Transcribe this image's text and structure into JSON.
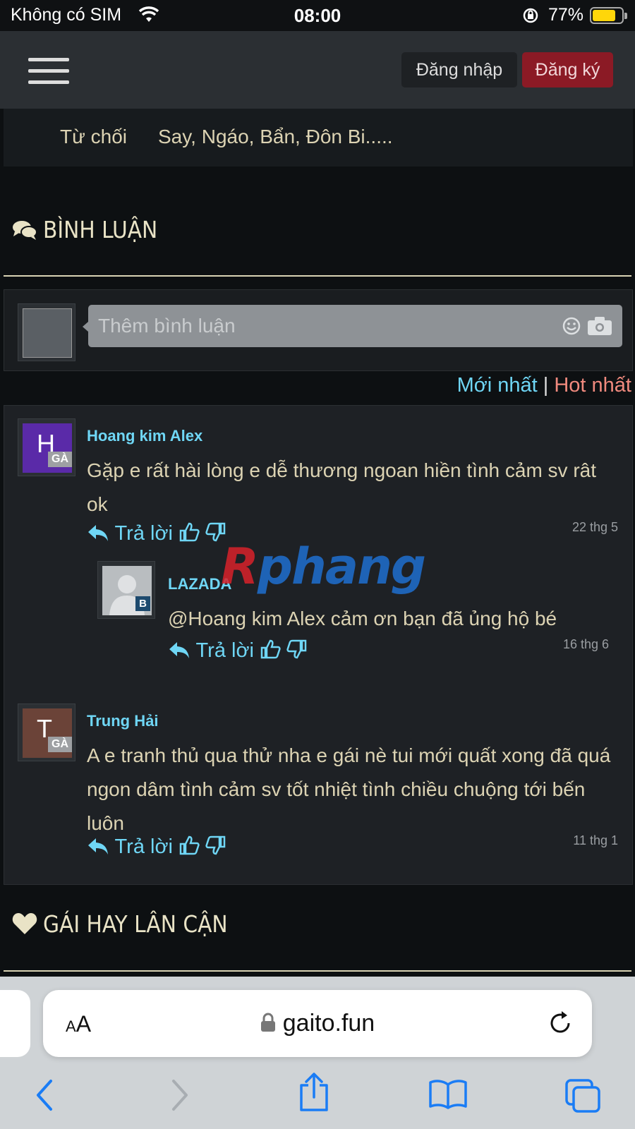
{
  "status_bar": {
    "carrier": "Không có SIM",
    "time": "08:00",
    "battery": "77%",
    "battery_level": 0.77,
    "battery_color": "#ffd60a"
  },
  "navbar": {
    "login_label": "Đăng nhập",
    "register_label": "Đăng ký",
    "register_color": "#8b1a25"
  },
  "profile_row": {
    "key": "Từ chối",
    "value": "Say, Ngáo, Bẩn, Đôn Bi....."
  },
  "comments_section": {
    "title": "BÌNH LUẬN",
    "input_placeholder": "Thêm bình luận",
    "sort_newest": "Mới nhất",
    "sort_separator": "|",
    "sort_hot": "Hot nhất",
    "comments": [
      {
        "avatar_letter": "H",
        "avatar_color": "#5a2aa8",
        "badge": "GÀ",
        "author": "Hoang kim Alex",
        "text": "Gặp e rất hài lòng e dễ thương ngoan hiền tình cảm sv rât ok",
        "reply_label": "Trả lời",
        "date": "22 thg 5",
        "replies": [
          {
            "badge": "B",
            "author": "LAZADA",
            "text": "@Hoang kim Alex cảm ơn bạn đã ủng hộ bé",
            "reply_label": "Trả lời",
            "date": "16 thg 6"
          }
        ]
      },
      {
        "avatar_letter": "T",
        "avatar_color": "#6b4338",
        "badge": "GÀ",
        "author": "Trung Hải",
        "text": "A e tranh thủ qua thử nha e gái nè tui mới quất xong đã quá ngon dâm tình cảm sv tốt nhiệt tình chiều chuộng tới bến luôn",
        "reply_label": "Trả lời",
        "date": "11 thg 1"
      }
    ]
  },
  "nearby_section": {
    "title": "GÁI HAY LÂN CẬN"
  },
  "watermark": {
    "part1": "R",
    "part2": "phang"
  },
  "browser": {
    "text_size_label": "AA",
    "host": "gaito.fun"
  }
}
